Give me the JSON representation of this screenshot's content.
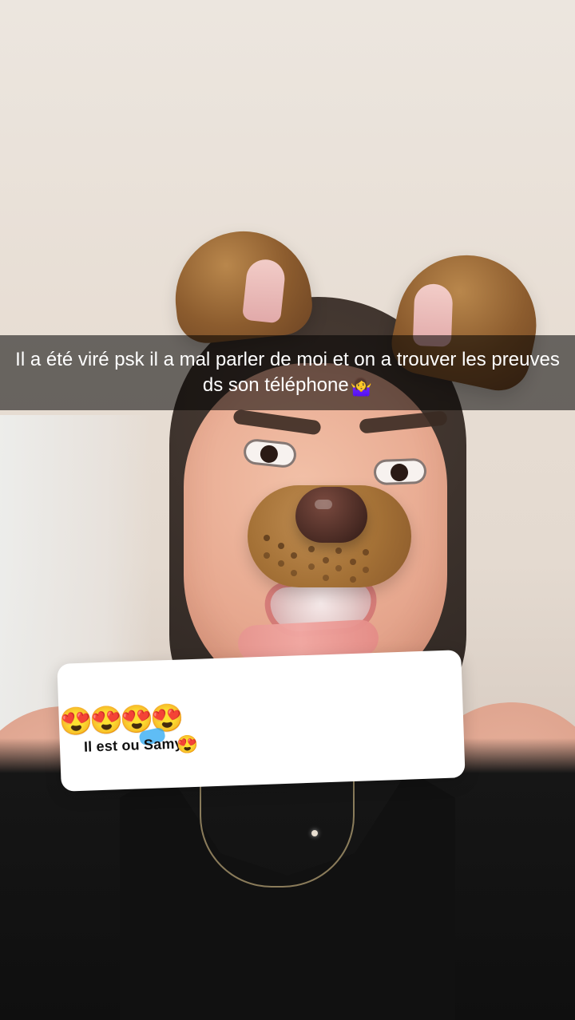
{
  "caption": {
    "text": "Il a été viré psk il a mal parler de moi et on a trouver les preuves ds son téléphone",
    "emoji": "🤷‍♀️"
  },
  "reply_sticker": {
    "emojis": [
      "😍",
      "😍",
      "😍",
      "😍"
    ],
    "question": "Il est ou Samy ?",
    "overlay_emoji": "😍"
  }
}
